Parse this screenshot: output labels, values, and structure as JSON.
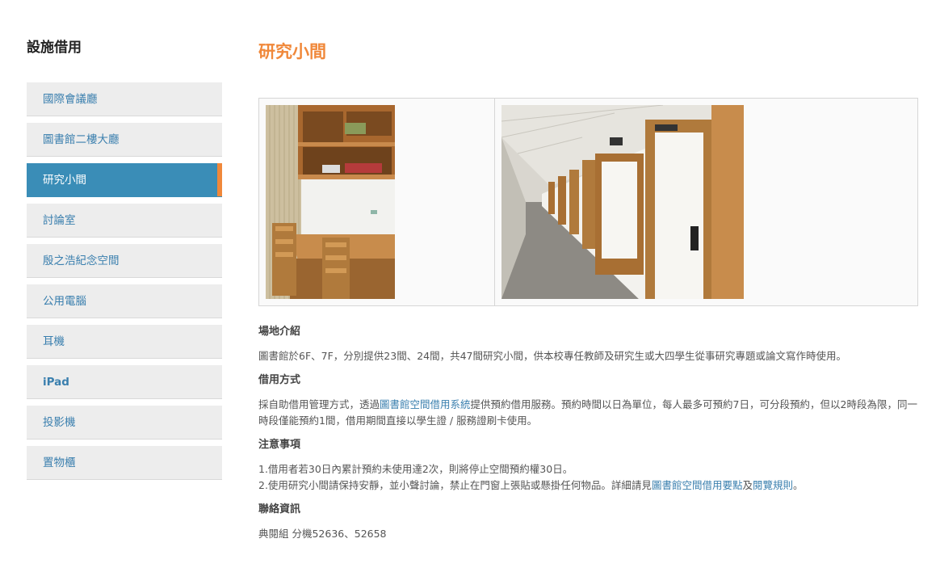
{
  "sidebar": {
    "title": "設施借用",
    "items": [
      {
        "label": "國際會議廳"
      },
      {
        "label": "圖書館二樓大廳"
      },
      {
        "label": "研究小間"
      },
      {
        "label": "討論室"
      },
      {
        "label": "殷之浩紀念空間"
      },
      {
        "label": "公用電腦"
      },
      {
        "label": "耳機"
      },
      {
        "label": "iPad"
      },
      {
        "label": "投影機"
      },
      {
        "label": "置物櫃"
      }
    ],
    "active_index": 2
  },
  "main": {
    "title": "研究小間",
    "sections": {
      "intro": {
        "heading": "場地介紹",
        "text": "圖書館於6F、7F，分別提供23間、24間，共47間研究小間，供本校專任教師及研究生或大四學生從事研究專題或論文寫作時使用。"
      },
      "borrow": {
        "heading": "借用方式",
        "text_before": "採自助借用管理方式，透過",
        "link": "圖書館空間借用系統",
        "text_after": "提供預約借用服務。預約時間以日為單位，每人最多可預約7日，可分段預約，但以2時段為限，同一時段僅能預約1間，借用期間直接以學生證 / 服務證刷卡使用。"
      },
      "notes": {
        "heading": "注意事項",
        "line1": "1.借用者若30日內累計預約未使用達2次，則將停止空間預約權30日。",
        "line2_before": "2.使用研究小間請保持安靜，並小聲討論，禁止在門窗上張貼或懸掛任何物品。詳細請見",
        "line2_link1": "圖書館空間借用要點",
        "line2_mid": "及",
        "line2_link2": "閱覽規則",
        "line2_after": "。"
      },
      "contact": {
        "heading": "聯絡資訊",
        "text": "典閱組 分機52636、52658"
      }
    }
  },
  "colors": {
    "accent_orange": "#f0883a",
    "active_blue": "#3a8db7",
    "link_blue": "#3a7fae"
  }
}
